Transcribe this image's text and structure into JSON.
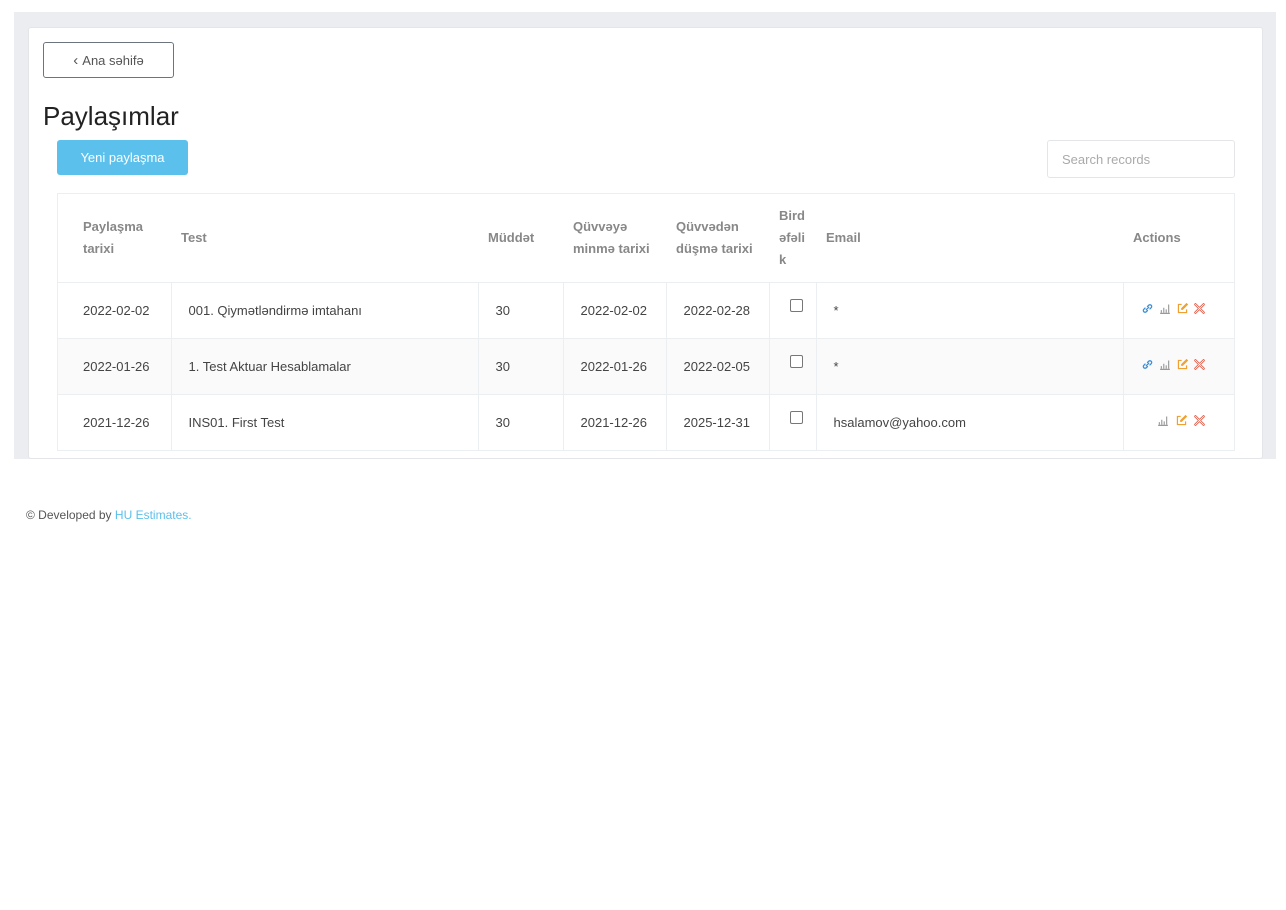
{
  "back_label": "Ana səhifə",
  "page_title": "Paylaşımlar",
  "new_button_label": "Yeni paylaşma",
  "search_placeholder": "Search records",
  "columns": [
    "Paylaşma tarixi",
    "Test",
    "Müddət",
    "Qüvvəyə minmə tarixi",
    "Qüvvədən düşmə tarixi",
    "Birdəfəlik",
    "Email",
    "Actions"
  ],
  "rows": [
    {
      "date": "2022-02-02",
      "test": "001. Qiymətləndirmə imtahanı",
      "duration": "30",
      "start": "2022-02-02",
      "end": "2022-02-28",
      "email": "*",
      "actions": [
        "link-icon",
        "stats-icon",
        "edit-icon",
        "delete-icon"
      ]
    },
    {
      "date": "2022-01-26",
      "test": "1. Test Aktuar Hesablamalar",
      "duration": "30",
      "start": "2022-01-26",
      "end": "2022-02-05",
      "email": "*",
      "actions": [
        "link-icon",
        "stats-icon",
        "edit-icon",
        "delete-icon"
      ]
    },
    {
      "date": "2021-12-26",
      "test": "INS01. First Test",
      "duration": "30",
      "start": "2021-12-26",
      "end": "2025-12-31",
      "email": "hsalamov@yahoo.com",
      "actions": [
        "stats-icon",
        "edit-icon",
        "delete-icon"
      ]
    }
  ],
  "footer": {
    "prefix": "© Developed by ",
    "link": "HU Estimates."
  },
  "colors": {
    "accent": "#5bc0eb",
    "link_icon": "#3a8fd8",
    "edit_icon": "#f0a030",
    "delete_icon": "#e0503a",
    "stats_icon": "#999999"
  }
}
